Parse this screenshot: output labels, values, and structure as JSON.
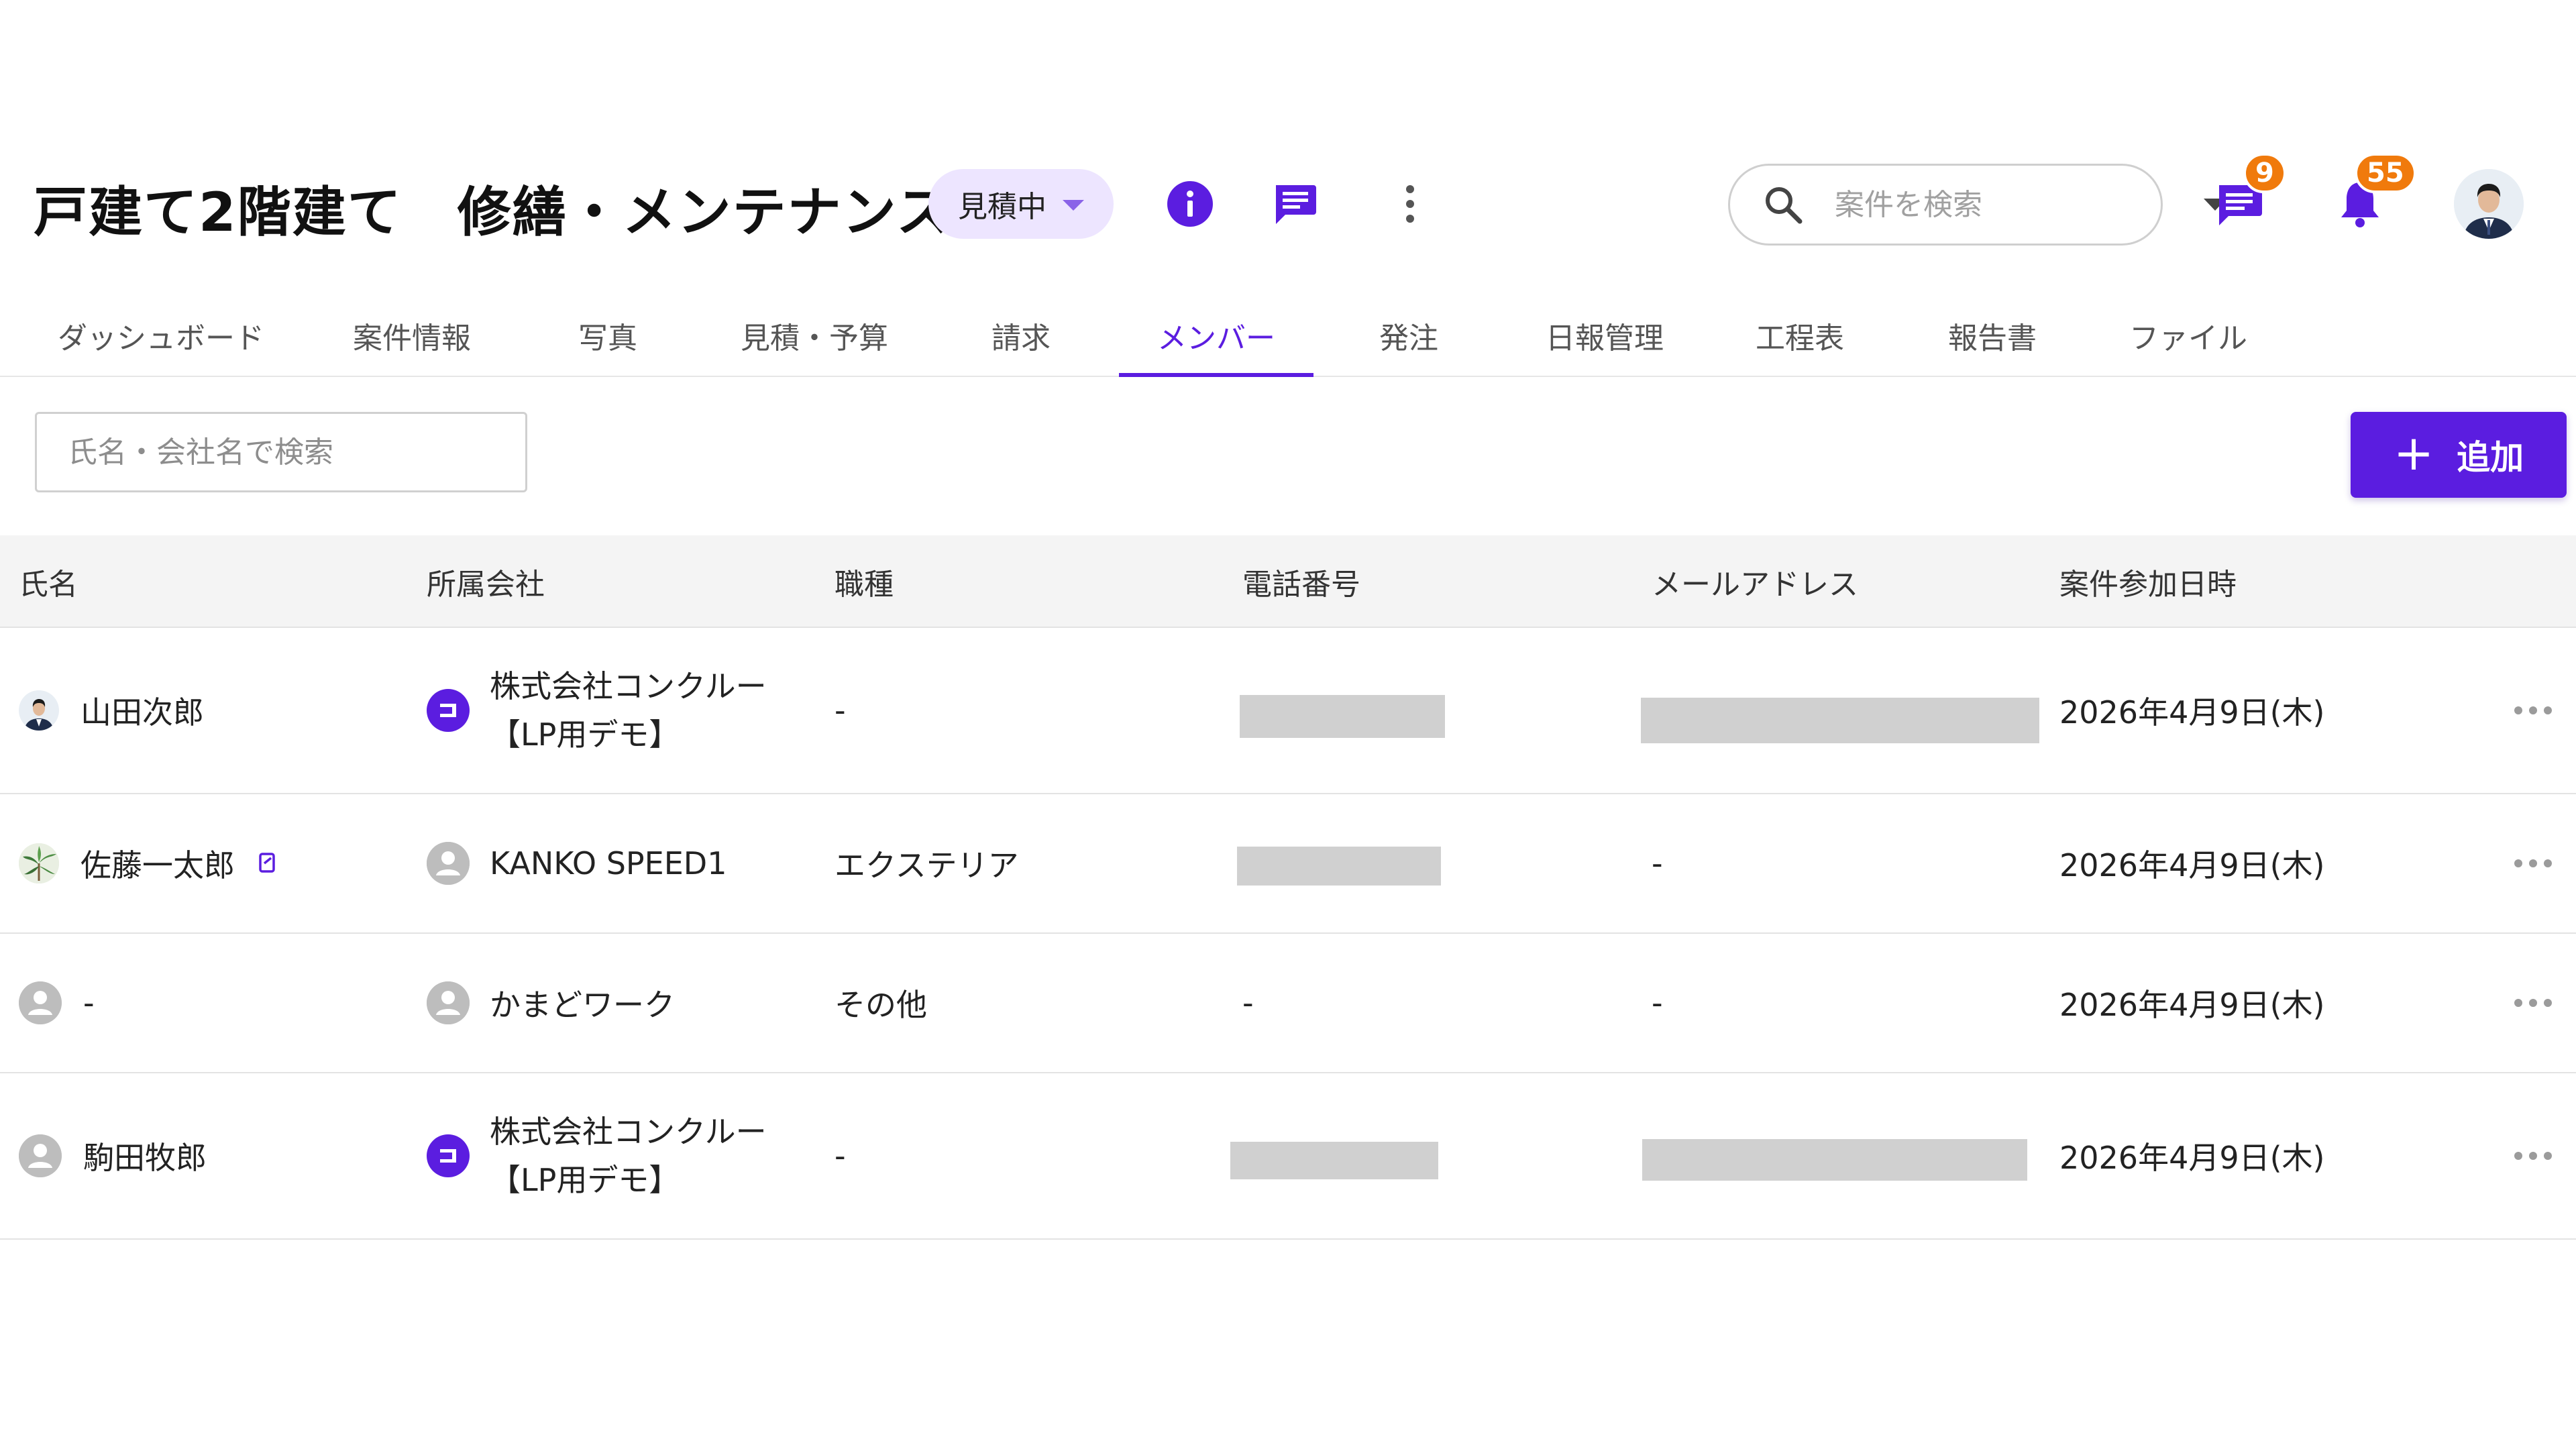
{
  "header": {
    "title": "戸建て2階建て　修繕・メンテナンス",
    "status_chip": "見積中",
    "search_placeholder": "案件を検索",
    "message_badge": "9",
    "notification_badge": "55"
  },
  "tabs": [
    {
      "label": "ダッシュボード"
    },
    {
      "label": "案件情報"
    },
    {
      "label": "写真"
    },
    {
      "label": "見積・予算"
    },
    {
      "label": "請求"
    },
    {
      "label": "メンバー",
      "active": true
    },
    {
      "label": "発注"
    },
    {
      "label": "日報管理"
    },
    {
      "label": "工程表"
    },
    {
      "label": "報告書"
    },
    {
      "label": "ファイル"
    }
  ],
  "toolbar": {
    "member_search_placeholder": "氏名・会社名で検索",
    "add_label": "追加"
  },
  "table": {
    "columns": [
      "氏名",
      "所属会社",
      "職種",
      "電話番号",
      "メールアドレス",
      "案件参加日時"
    ],
    "rows": [
      {
        "name": "山田次郎",
        "company_line1": "株式会社コンクルー",
        "company_line2": "【LP用デモ】",
        "job": "-",
        "phone": "",
        "email": "",
        "joined": "2026年4月9日(木)"
      },
      {
        "name": "佐藤一太郎",
        "company": "KANKO SPEED1",
        "job": "エクステリア",
        "phone": "",
        "email": "-",
        "joined": "2026年4月9日(木)"
      },
      {
        "name": "-",
        "company": "かまどワーク",
        "job": "その他",
        "phone": "-",
        "email": "-",
        "joined": "2026年4月9日(木)"
      },
      {
        "name": "駒田牧郎",
        "company_line1": "株式会社コンクルー",
        "company_line2": "【LP用デモ】",
        "job": "-",
        "phone": "",
        "email": "",
        "joined": "2026年4月9日(木)"
      }
    ]
  },
  "colors": {
    "accent": "#5b1de0",
    "badge": "#f07a0c",
    "chip_bg": "#ede5ff",
    "redaction": "#d0d0d0"
  }
}
